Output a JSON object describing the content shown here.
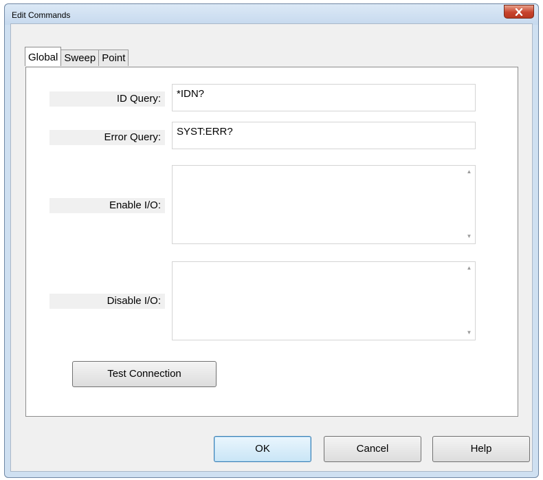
{
  "window": {
    "title": "Edit Commands"
  },
  "tabs": [
    {
      "label": "Global",
      "active": true
    },
    {
      "label": "Sweep",
      "active": false
    },
    {
      "label": "Point",
      "active": false
    }
  ],
  "fields": {
    "id_query": {
      "label": "ID Query:",
      "value": "*IDN?"
    },
    "error_query": {
      "label": "Error Query:",
      "value": "SYST:ERR?"
    },
    "enable_io": {
      "label": "Enable I/O:",
      "value": ""
    },
    "disable_io": {
      "label": "Disable I/O:",
      "value": ""
    }
  },
  "buttons": {
    "test_connection": "Test Connection",
    "ok": "OK",
    "cancel": "Cancel",
    "help": "Help"
  },
  "icons": {
    "close": "close-icon",
    "scroll_up": "scroll-up-arrow-icon",
    "scroll_down": "scroll-down-arrow-icon"
  }
}
